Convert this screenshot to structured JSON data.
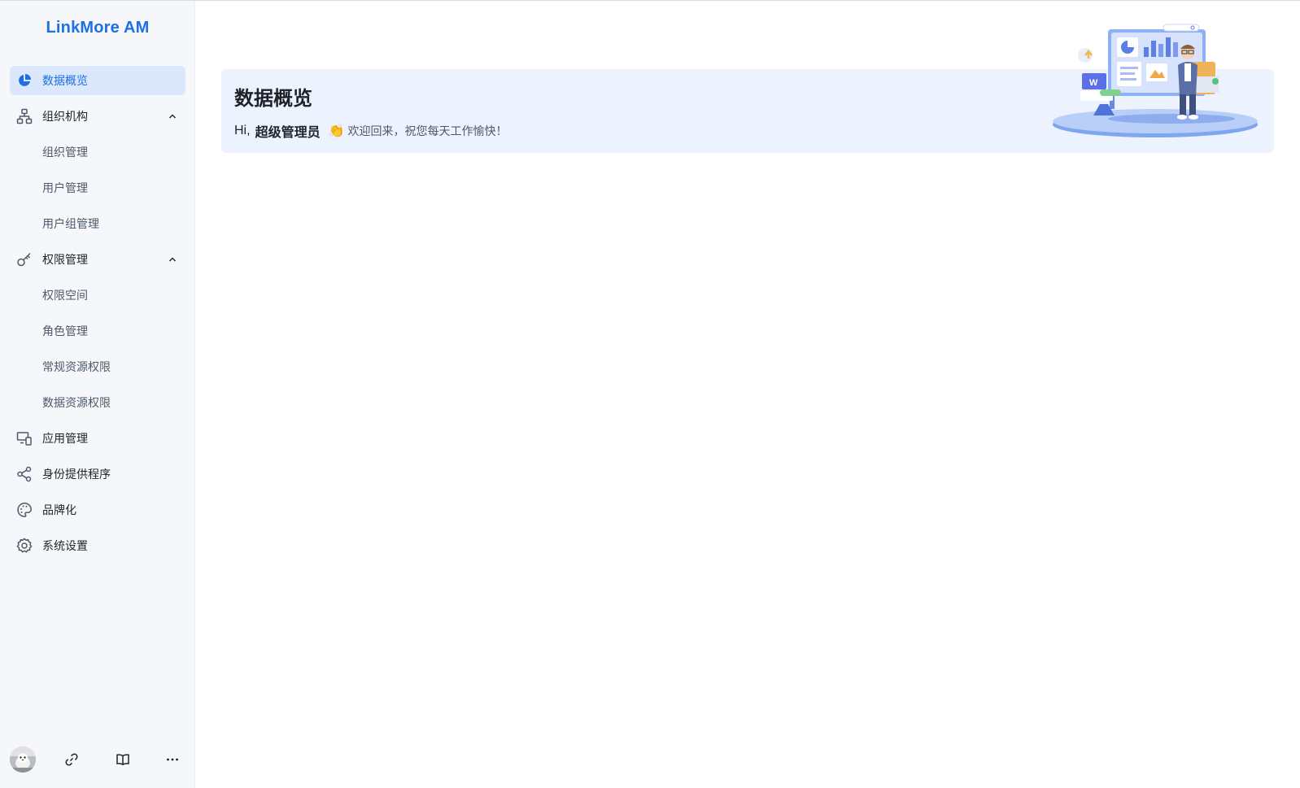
{
  "app": {
    "title": "LinkMore AM"
  },
  "sidebar": {
    "items": [
      {
        "label": "数据概览",
        "icon": "pie-chart-icon",
        "active": true
      },
      {
        "label": "组织机构",
        "icon": "org-tree-icon",
        "expanded": true
      },
      {
        "label": "组织管理"
      },
      {
        "label": "用户管理"
      },
      {
        "label": "用户组管理"
      },
      {
        "label": "权限管理",
        "icon": "key-icon",
        "expanded": true
      },
      {
        "label": "权限空间"
      },
      {
        "label": "角色管理"
      },
      {
        "label": "常规资源权限"
      },
      {
        "label": "数据资源权限"
      },
      {
        "label": "应用管理",
        "icon": "app-devices-icon"
      },
      {
        "label": "身份提供程序",
        "icon": "share-nodes-icon"
      },
      {
        "label": "品牌化",
        "icon": "palette-icon"
      },
      {
        "label": "系统设置",
        "icon": "gear-icon"
      }
    ],
    "bottom": {
      "icons": [
        "link-icon",
        "book-icon",
        "more-icon"
      ]
    }
  },
  "main": {
    "page_title": "数据概览",
    "greeting_prefix": "Hi,",
    "user_name": "超级管理员",
    "clap": "👏",
    "welcome": "欢迎回来，祝您每天工作愉快！"
  },
  "colors": {
    "accent": "#1f6fe5",
    "active_bg": "#dbe8fb",
    "banner_bg": "#edf3fe",
    "sidebar_bg": "#f5f7fa"
  }
}
